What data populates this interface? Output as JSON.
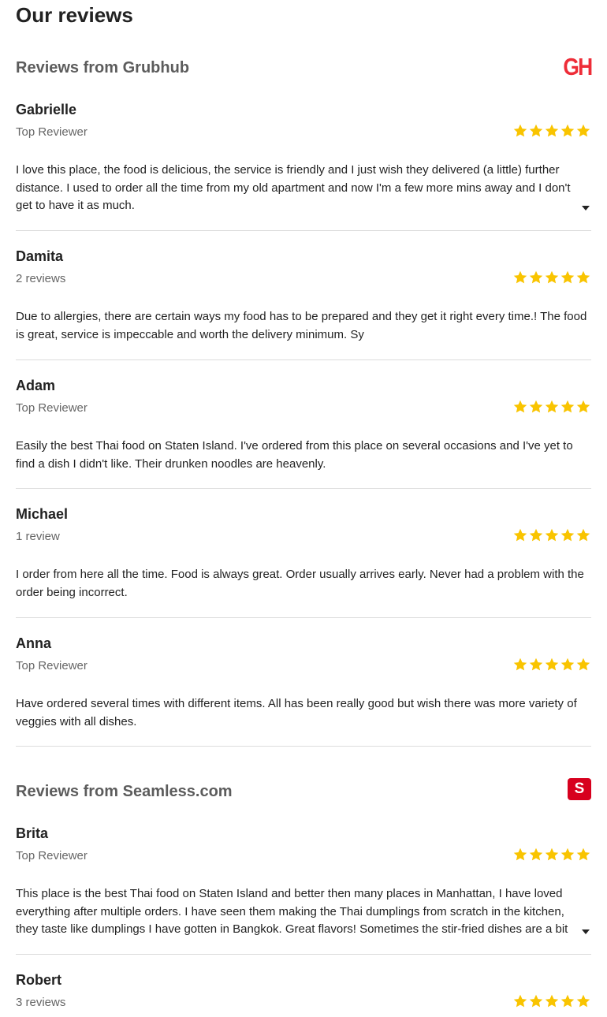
{
  "page_title": "Our reviews",
  "colors": {
    "star": "#f9c400",
    "grubhub": "#ee2d38",
    "seamless": "#d7001e"
  },
  "sections": [
    {
      "title": "Reviews from Grubhub",
      "logo_text": "GH",
      "reviews": [
        {
          "name": "Gabrielle",
          "meta": "Top Reviewer",
          "rating": 5,
          "text": "I love this place, the food is delicious, the service is friendly and I just wish they delivered (a little) further distance. I used to order all the time from my old apartment and now I'm a few more mins away and I don't get to have it as much.",
          "expandable": true
        },
        {
          "name": "Damita",
          "meta": "2 reviews",
          "rating": 5,
          "text": "Due to allergies, there are certain ways my food has to be prepared and they get it right every time.! The food is great, service is impeccable and worth the delivery minimum. Sy",
          "expandable": false
        },
        {
          "name": "Adam",
          "meta": "Top Reviewer",
          "rating": 5,
          "text": "Easily the best Thai food on Staten Island. I've ordered from this place on several occasions and I've yet to find a dish I didn't like. Their drunken noodles are heavenly.",
          "expandable": false
        },
        {
          "name": "Michael",
          "meta": "1 review",
          "rating": 5,
          "text": "I order from here all the time. Food is always great. Order usually arrives early. Never had a problem with the order being incorrect.",
          "expandable": false
        },
        {
          "name": "Anna",
          "meta": "Top Reviewer",
          "rating": 5,
          "text": "Have ordered several times with different items. All has been really good but wish there was more variety of veggies with all dishes.",
          "expandable": false
        }
      ]
    },
    {
      "title": "Reviews from Seamless.com",
      "logo_text": "S",
      "reviews": [
        {
          "name": "Brita",
          "meta": "Top Reviewer",
          "rating": 5,
          "text_lines": [
            "This place is the best Thai food on Staten Island and better then many places in Manhattan, I have loved",
            "everything after multiple orders. I have seen them making the Thai dumplings from scratch in the kitchen,",
            "they taste like dumplings I have gotten in Bangkok. Great flavors! Sometimes the stir-fried dishes are a bit"
          ],
          "expandable": true
        },
        {
          "name": "Robert",
          "meta": "3 reviews",
          "rating": 5
        }
      ]
    }
  ]
}
